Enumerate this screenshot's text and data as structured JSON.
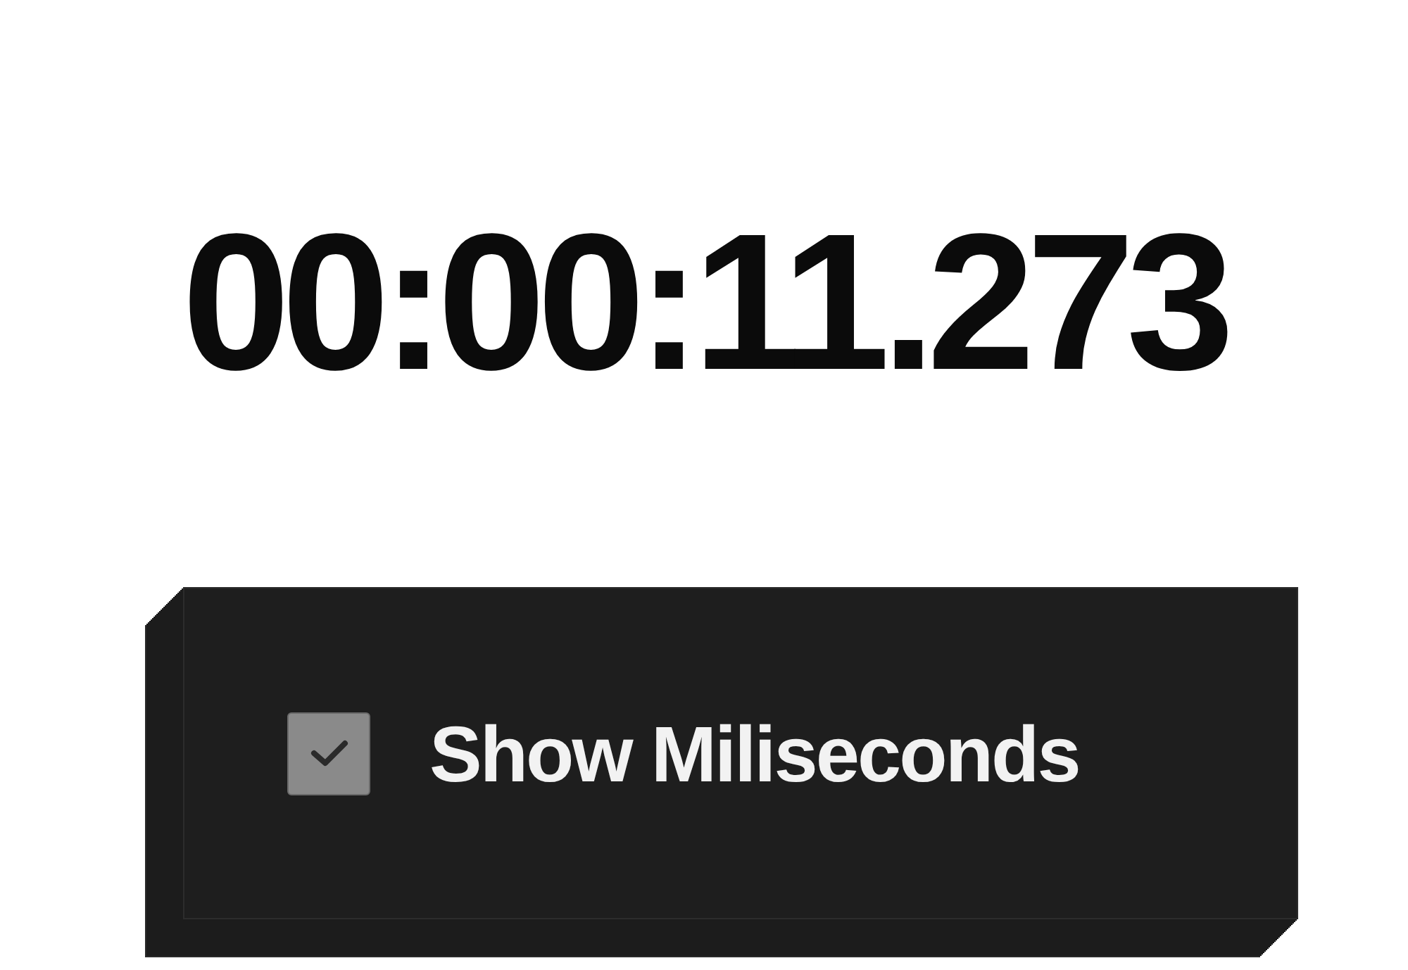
{
  "timer": {
    "display": "00:00:11.273"
  },
  "milliseconds_toggle": {
    "label": "Show Miliseconds",
    "checked": true
  }
}
